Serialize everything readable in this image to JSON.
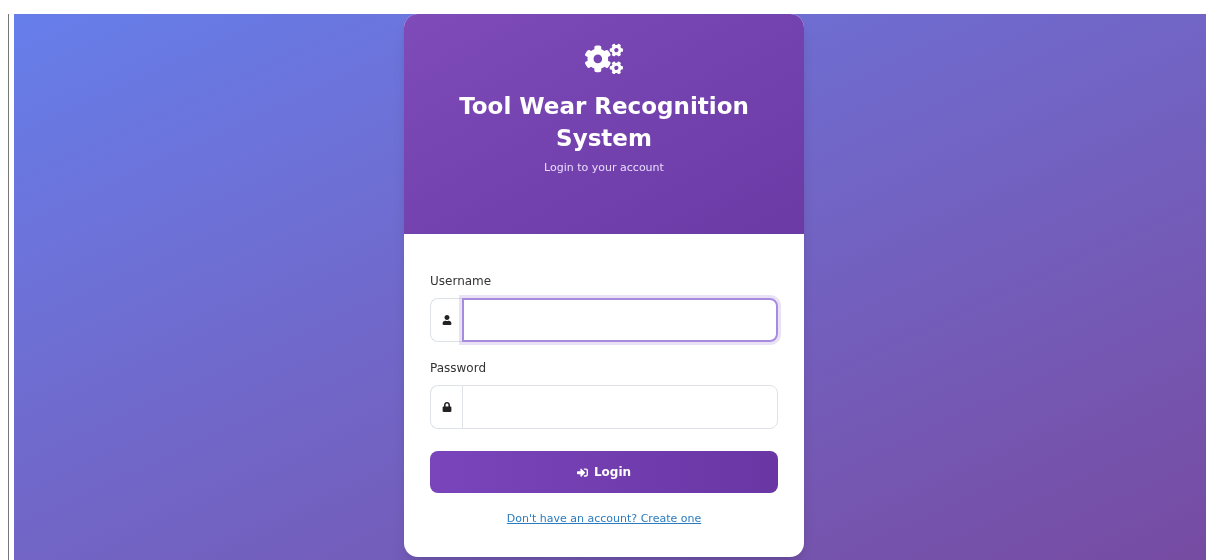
{
  "header": {
    "title": "Tool Wear Recognition System",
    "subtitle": "Login to your account"
  },
  "fields": [
    {
      "label": "Username",
      "kind": "user",
      "focused": true
    },
    {
      "label": "Password",
      "kind": "lock",
      "focused": false
    }
  ],
  "login_button": {
    "label": "Login"
  },
  "signup_link": {
    "text": "Don't have an account? Create one"
  }
}
